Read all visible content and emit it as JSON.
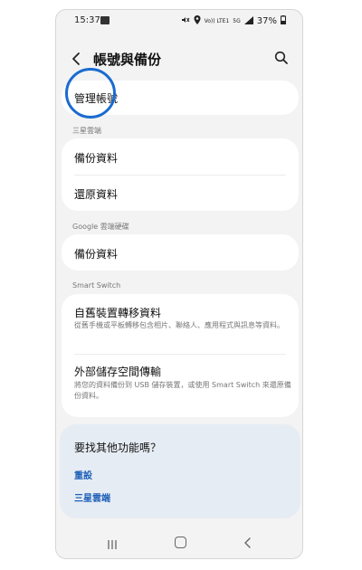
{
  "status_bar": {
    "time": "15:37",
    "battery": "37%",
    "network_label": "Vo)) LTE1",
    "signal_label": "5G"
  },
  "header": {
    "title": "帳號與備份"
  },
  "manage_accounts": {
    "label": "管理帳號"
  },
  "samsung_cloud": {
    "section_label": "三星雲端",
    "items": [
      {
        "label": "備份資料"
      },
      {
        "label": "還原資料"
      }
    ]
  },
  "google_drive": {
    "section_label": "Google 雲端硬碟",
    "items": [
      {
        "label": "備份資料"
      }
    ]
  },
  "smart_switch": {
    "section_label": "Smart Switch",
    "items": [
      {
        "label": "自舊裝置轉移資料",
        "description": "從舊手機或平板轉移包含相片、聯絡人、應用程式與訊息等資料。"
      },
      {
        "label": "外部儲存空間傳輸",
        "description": "將您的資料備份到 USB 儲存裝置，或使用 Smart Switch 來還原備份資料。"
      }
    ]
  },
  "suggestions": {
    "title": "要找其他功能嗎？",
    "links": [
      {
        "label": "重設"
      },
      {
        "label": "三星雲端"
      }
    ]
  },
  "colors": {
    "accent": "#1a6bd1",
    "link": "#1c5fb8",
    "background": "#f3f3f3",
    "card": "#ffffff",
    "suggest_card": "#e6ecf3"
  },
  "icons": {
    "back": "chevron-left-icon",
    "search": "search-icon",
    "gallery": "gallery-icon",
    "mute": "mute-icon",
    "location": "location-icon",
    "signal": "signal-icon",
    "battery": "battery-icon",
    "nav_recent": "recent-apps-icon",
    "nav_home": "home-icon",
    "nav_back": "back-icon"
  }
}
